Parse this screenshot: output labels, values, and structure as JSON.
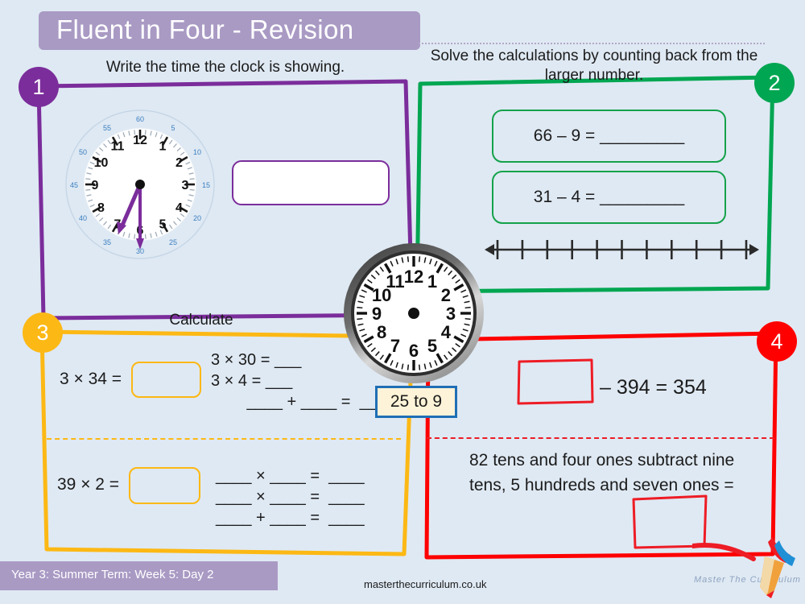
{
  "header": {
    "title": "Fluent in Four - Revision"
  },
  "sections": [
    {
      "number": "1",
      "color": "#7B2D9B",
      "prompt": "Write the time the clock is showing.",
      "clock": {
        "hours": [
          12,
          1,
          2,
          3,
          4,
          5,
          6,
          7,
          8,
          9,
          10,
          11
        ],
        "minute_labels": [
          5,
          10,
          15,
          20,
          25,
          30,
          35,
          40,
          45,
          50,
          55,
          60
        ],
        "hour_hand_value": 6.5,
        "minute_hand_value": 30
      },
      "answer_placeholder": ""
    },
    {
      "number": "2",
      "color": "#00A651",
      "prompt": "Solve the calculations by counting back from the larger number.",
      "calculations": [
        "66 – 9 = _________",
        "31 – 4 = _________"
      ],
      "number_line_ticks": 11
    },
    {
      "number": "3",
      "color": "#FCB814",
      "prompt": "Calculate",
      "rows": [
        {
          "equation": "3 × 34 =",
          "working": "3 × 30 = ___\n3 × 4 = ___\n        ____ + ____ =  ____",
          "answer_placeholder": ""
        },
        {
          "equation": "39 × 2 =",
          "working": "____ × ____ =  ____\n____ × ____ =  ____\n____ + ____ =  ____",
          "answer_placeholder": ""
        }
      ]
    },
    {
      "number": "4",
      "color": "#FF0000",
      "prompt": "",
      "equation": "– 394 = 354",
      "word_problem": "82 tens and four ones subtract nine tens, 5 hundreds and seven ones =",
      "answer_placeholder": ""
    }
  ],
  "centre_clock": {
    "hours": [
      12,
      1,
      2,
      3,
      4,
      5,
      6,
      7,
      8,
      9,
      10,
      11
    ],
    "time_label": "25 to 9"
  },
  "footer": {
    "lesson": "Year 3: Summer Term: Week 5: Day 2",
    "url": "masterthecurriculum.co.uk",
    "brand": "Master  The  Curriculum"
  },
  "palette": {
    "background": "#dfe9f3",
    "banner": "#a99ac4",
    "purple": "#7B2D9B",
    "green": "#00A651",
    "amber": "#FCB814",
    "red": "#FF0000",
    "label_border": "#1f6fb5",
    "label_fill": "#fdf3d8"
  }
}
